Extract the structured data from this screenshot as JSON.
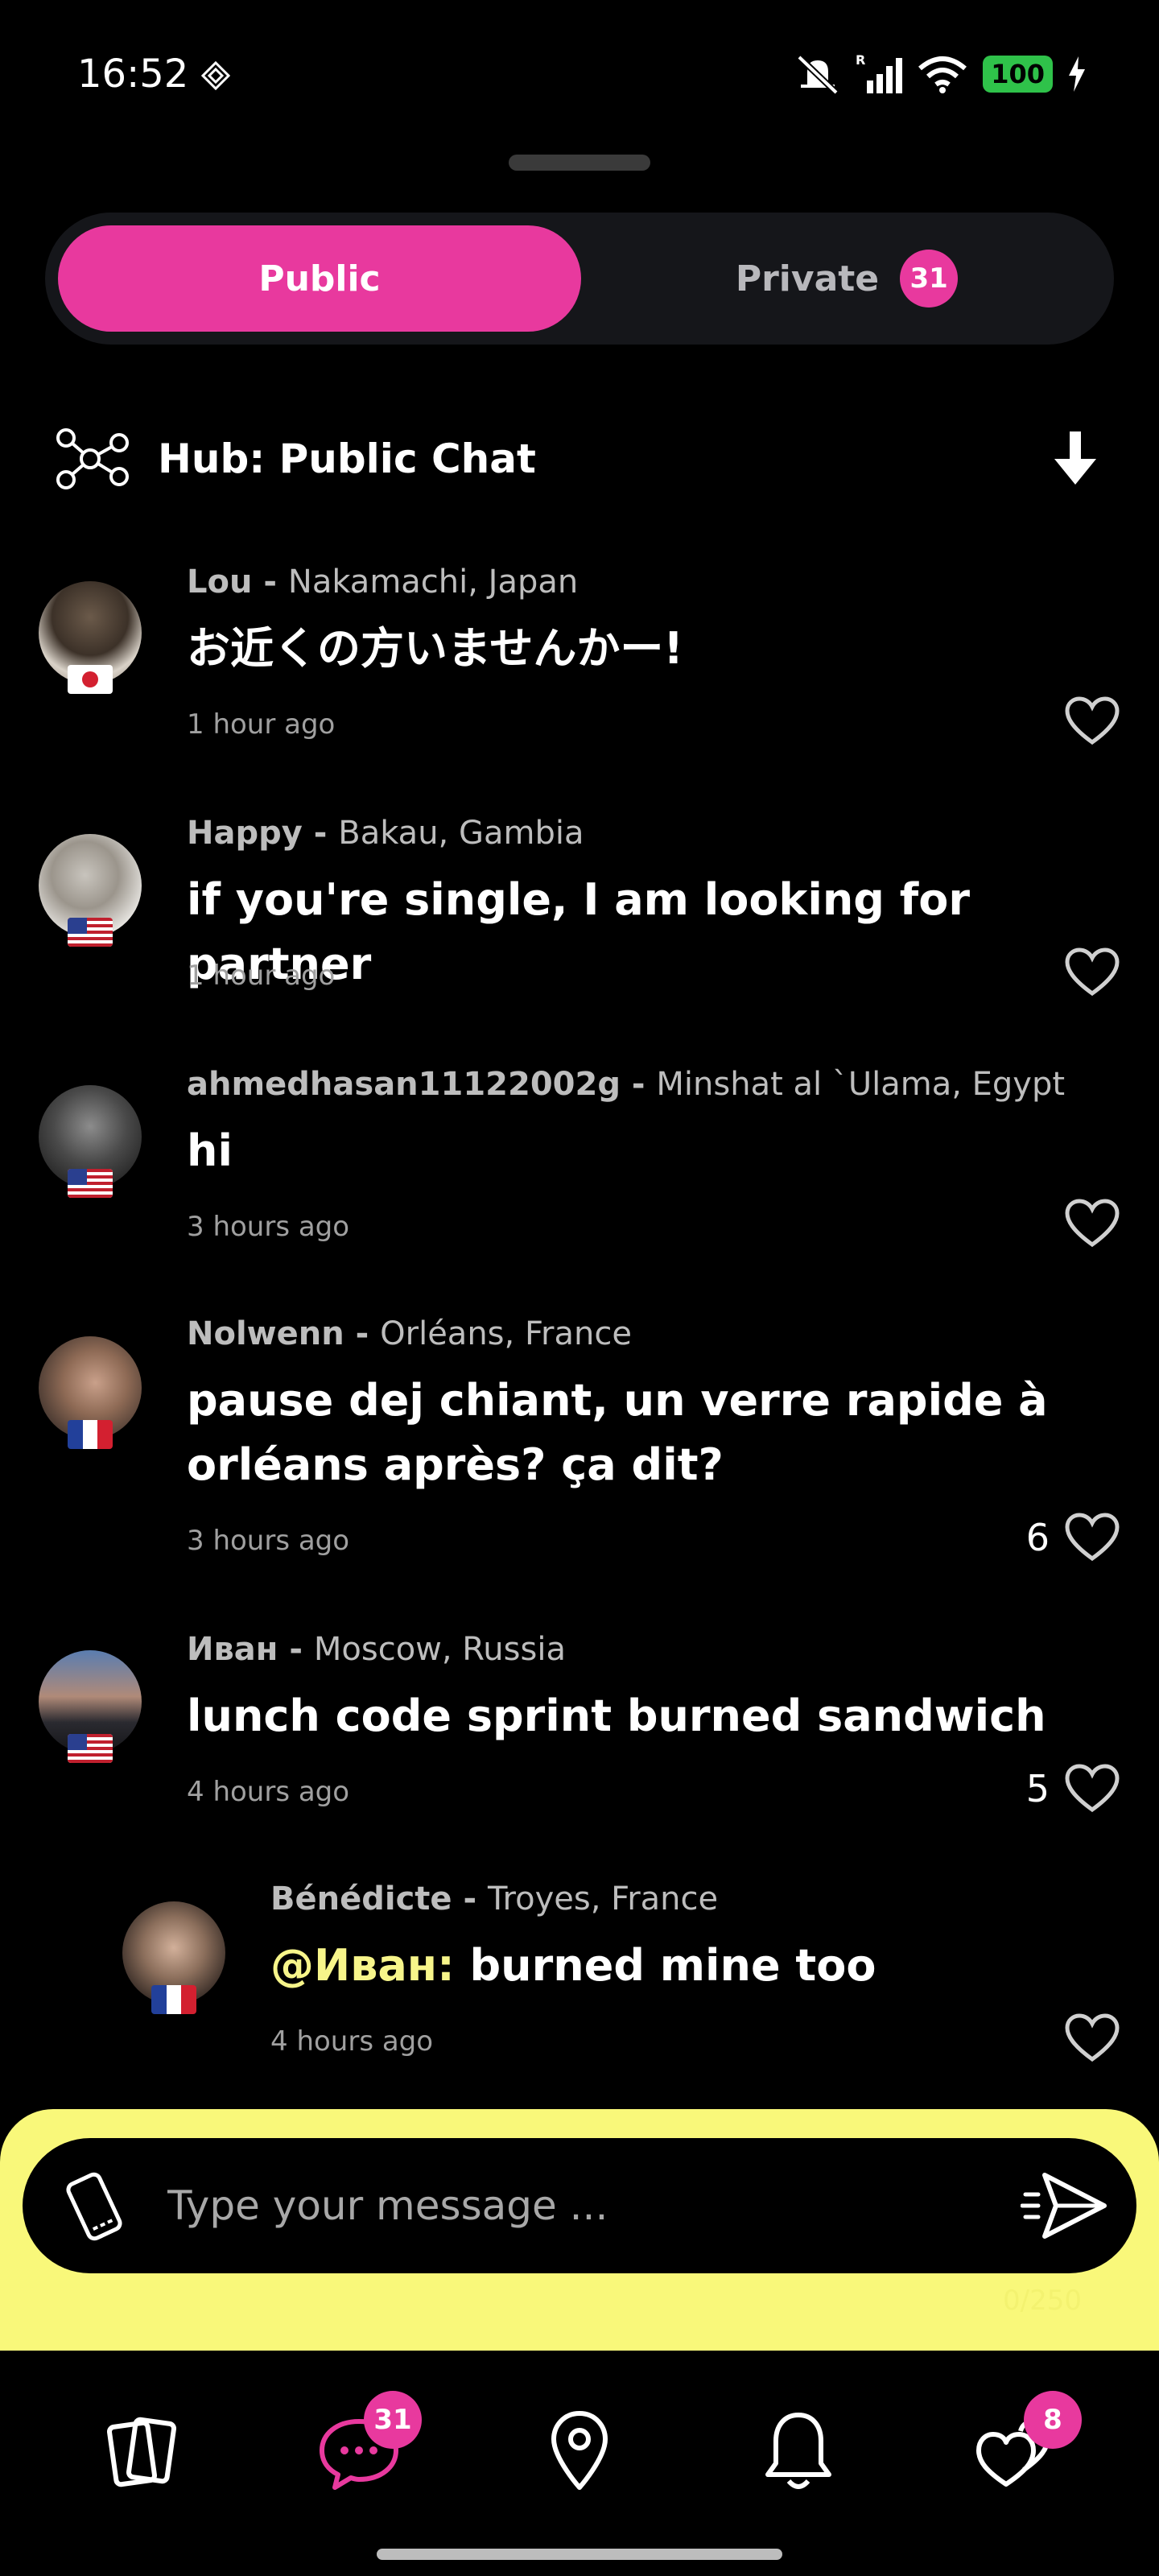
{
  "status_bar": {
    "time": "16:52",
    "battery": "100",
    "signal_label": "R"
  },
  "tabs": {
    "public_label": "Public",
    "private_label": "Private",
    "private_badge": "31"
  },
  "hub": {
    "title": "Hub: Public Chat"
  },
  "messages": [
    {
      "username": "Lou",
      "separator": " - ",
      "location": "Nakamachi, Japan",
      "text": "お近くの方いませんかー!",
      "time": "1 hour ago",
      "likes": "",
      "flag": "japan"
    },
    {
      "username": "Happy",
      "separator": " - ",
      "location": "Bakau, Gambia",
      "text": "if you're single, I am looking for partner",
      "time": "1 hour ago",
      "likes": "",
      "flag": "usa"
    },
    {
      "username": "ahmedhasan11122002g",
      "separator": " - ",
      "location": "Minshat al `Ulama, Egypt",
      "text": "hi",
      "time": "3 hours ago",
      "likes": "",
      "flag": "usa"
    },
    {
      "username": "Nolwenn",
      "separator": " - ",
      "location": "Orléans, France",
      "text_line1": "pause dej chiant, un verre rapide à",
      "text_line2": "orléans après? ça dit?",
      "time": "3 hours ago",
      "likes": "6",
      "flag": "france"
    },
    {
      "username": "Иван",
      "separator": " - ",
      "location": "Moscow, Russia",
      "text": "lunch code sprint burned sandwich",
      "time": "4 hours ago",
      "likes": "5",
      "flag": "usa"
    },
    {
      "username": "Bénédicte",
      "separator": " - ",
      "location": "Troyes, France",
      "mention": "@Иван:",
      "text": " burned mine too",
      "time": "4 hours ago",
      "likes": "",
      "flag": "france"
    }
  ],
  "composer": {
    "placeholder": "Type your message ...",
    "counter": "0/250"
  },
  "bottom_nav": {
    "chat_badge": "31",
    "matches_badge": "8",
    "items": [
      "cards-icon",
      "chat-icon",
      "location-pin-icon",
      "bell-icon",
      "hearts-icon"
    ]
  },
  "colors": {
    "accent": "#e8399e",
    "composer_bg": "#f9f87a",
    "mention": "#f7f58a"
  }
}
